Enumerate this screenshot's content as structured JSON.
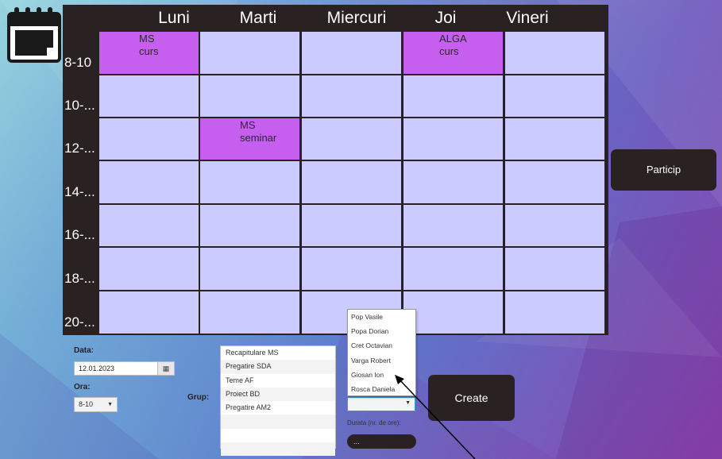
{
  "days": [
    "Luni",
    "Marti",
    "Miercuri",
    "Joi",
    "Vineri"
  ],
  "hours": [
    "8-10",
    "10-...",
    "12-...",
    "14-...",
    "16-...",
    "18-...",
    "20-..."
  ],
  "bookings": [
    {
      "row": 0,
      "col": 0,
      "text": "MS\ncurs"
    },
    {
      "row": 0,
      "col": 3,
      "text": "ALGA\ncurs"
    },
    {
      "row": 2,
      "col": 1,
      "text": "MS\nseminar"
    }
  ],
  "form": {
    "data_label": "Data:",
    "data_value": "12.01.2023",
    "ora_label": "Ora:",
    "ora_value": "8-10",
    "grup_label": "Grup:",
    "grup_items": [
      "Recapitulare MS",
      "Pregatire SDA",
      "Teme AF",
      "Proiect BD",
      "Pregatire AM2"
    ],
    "participant_options": [
      "Pop Vasile",
      "Popa Dorian",
      "Cret Octavian",
      "Varga Robert",
      "Giosan Ion",
      "Rosca Daniela"
    ],
    "durata_label": "Durata (nr. de ore):",
    "durata_value": "..."
  },
  "buttons": {
    "create": "Create",
    "particip": "Particip"
  },
  "colors": {
    "cell": "#cccbff",
    "booked": "#c65ff0",
    "dark": "#2a2222"
  },
  "icons": {
    "app": "calendar-icon",
    "date": "calendar-picker-icon",
    "dropdown": "chevron-down-icon"
  }
}
